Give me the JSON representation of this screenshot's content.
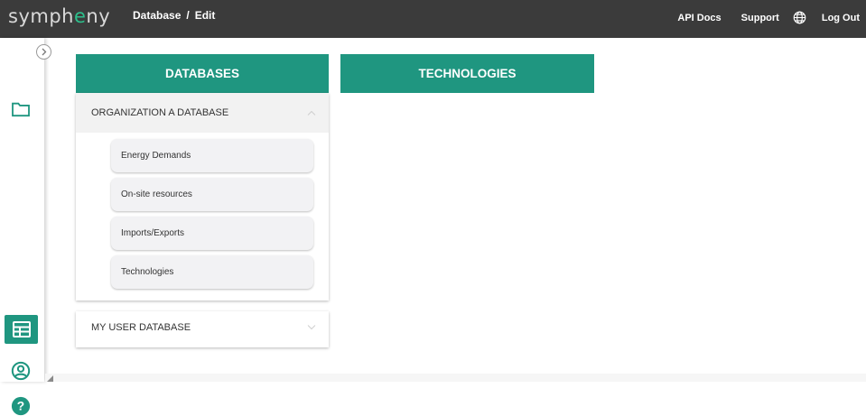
{
  "app": {
    "logo_prefix": "symph",
    "logo_accent": "e",
    "logo_suffix": "ny"
  },
  "breadcrumb": {
    "parent": "Database",
    "separator": "/",
    "current": "Edit"
  },
  "topnav": {
    "api_docs": "API Docs",
    "support": "Support",
    "language_icon": "globe-icon",
    "logout": "Log Out"
  },
  "sidebar": {
    "icons": [
      "chevron-right-icon",
      "folder-icon",
      "table-icon",
      "user-circle-icon",
      "help-icon"
    ]
  },
  "panels": {
    "databases_title": "DATABASES",
    "technologies_title": "TECHNOLOGIES"
  },
  "databases": [
    {
      "name": "ORGANIZATION A DATABASE",
      "expanded": true,
      "items": [
        "Energy Demands",
        "On-site resources",
        "Imports/Exports",
        "Technologies"
      ]
    },
    {
      "name": "MY USER DATABASE",
      "expanded": false,
      "items": []
    }
  ],
  "colors": {
    "accent": "#1f9680",
    "topbar": "#3b3b3b",
    "logo_accent": "#2dbf8c"
  }
}
